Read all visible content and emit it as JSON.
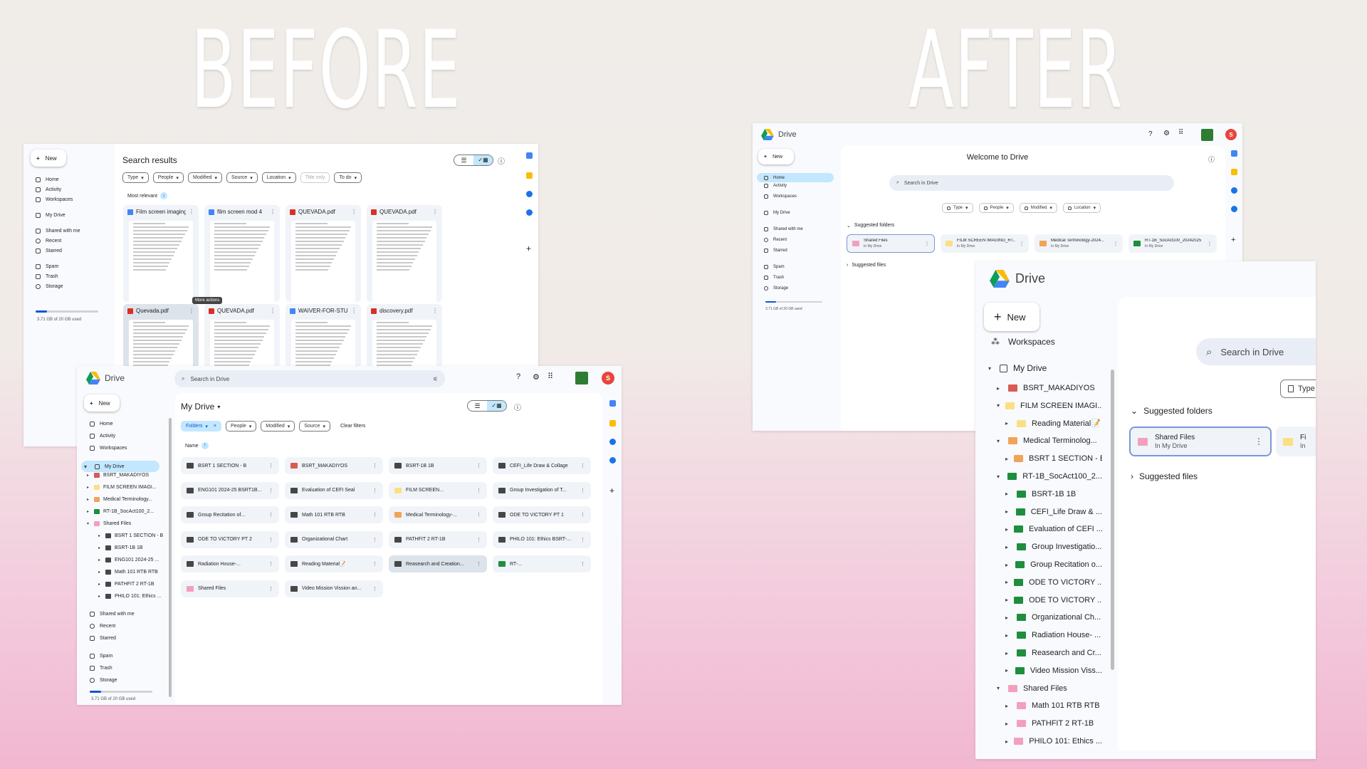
{
  "headings": {
    "before": "BEFORE",
    "after": "AFTER"
  },
  "colors": {
    "accent": "#0b57d0",
    "sidebar_active": "#c2e7ff",
    "avatar": "#e8453c",
    "folder_pink": "#f2a0bd",
    "folder_yellow": "#fbe083",
    "folder_orange": "#f2a35a",
    "folder_green": "#1e8e3e",
    "folder_red": "#d85b55",
    "folder_dark": "#444746"
  },
  "p1": {
    "new": "New",
    "nav": [
      {
        "label": "Home",
        "icon": "home-icon"
      },
      {
        "label": "Activity",
        "icon": "bell-icon"
      },
      {
        "label": "Workspaces",
        "icon": "workspaces-icon"
      },
      {
        "label": "My Drive",
        "icon": "drive-icon"
      },
      {
        "label": "Shared with me",
        "icon": "people-icon"
      },
      {
        "label": "Recent",
        "icon": "clock-icon"
      },
      {
        "label": "Starred",
        "icon": "star-icon"
      },
      {
        "label": "Spam",
        "icon": "spam-icon"
      },
      {
        "label": "Trash",
        "icon": "trash-icon"
      },
      {
        "label": "Storage",
        "icon": "cloud-icon"
      }
    ],
    "storage": "3.71 GB of 20 GB used",
    "storage_fraction": 0.186,
    "title": "Search results",
    "chips": [
      "Type",
      "People",
      "Modified",
      "Source",
      "Location",
      "Title only",
      "To do"
    ],
    "sort": "Most relevant",
    "tooltip": "More actions",
    "files": [
      "Film screen imaging mod...",
      "film screen mod 4",
      "QUEVADA.pdf",
      "QUEVADA.pdf",
      "Quevada.pdf",
      "QUEVADA.pdf",
      "WAIVER-FOR-STUDENT...",
      "discovery.pdf"
    ]
  },
  "p2": {
    "brand": "Drive",
    "search": "Search in Drive",
    "new": "New",
    "avatar": "S",
    "nav_top": [
      {
        "label": "Home",
        "icon": "home-icon"
      },
      {
        "label": "Activity",
        "icon": "bell-icon"
      },
      {
        "label": "Workspaces",
        "icon": "workspaces-icon"
      }
    ],
    "my_drive": "My Drive",
    "tree": [
      {
        "label": "BSRT_MAKADIYOS",
        "color": "#d85b55",
        "indent": 1
      },
      {
        "label": "FILM SCREEN IMAGI...",
        "color": "#fbe083",
        "indent": 1
      },
      {
        "label": "Medical Terminology...",
        "color": "#f2a35a",
        "indent": 1
      },
      {
        "label": "RT-1B_SocAct100_2...",
        "color": "#1e8e3e",
        "indent": 1
      },
      {
        "label": "Shared Files",
        "color": "#f2a0bd",
        "indent": 1
      },
      {
        "label": "BSRT 1 SECTION - B",
        "color": "#444746",
        "indent": 2
      },
      {
        "label": "BSRT-1B 1B",
        "color": "#444746",
        "indent": 2
      },
      {
        "label": "ENG101 2024-25 ...",
        "color": "#444746",
        "indent": 2
      },
      {
        "label": "Math 101 RTB RTB",
        "color": "#444746",
        "indent": 2
      },
      {
        "label": "PATHFIT 2 RT-1B",
        "color": "#444746",
        "indent": 2
      },
      {
        "label": "PHILO 101: Ethics ...",
        "color": "#444746",
        "indent": 2
      }
    ],
    "nav_bottom": [
      {
        "label": "Shared with me",
        "icon": "people-icon"
      },
      {
        "label": "Recent",
        "icon": "clock-icon"
      },
      {
        "label": "Starred",
        "icon": "star-icon"
      },
      {
        "label": "Spam",
        "icon": "spam-icon"
      },
      {
        "label": "Trash",
        "icon": "trash-icon"
      },
      {
        "label": "Storage",
        "icon": "cloud-icon"
      }
    ],
    "storage": "3.71 GB of 20 GB used",
    "storage_fraction": 0.186,
    "title": "My Drive",
    "chips": [
      "Folders",
      "People",
      "Modified",
      "Source"
    ],
    "clear": "Clear filters",
    "col": "Name",
    "folders": [
      {
        "label": "BSRT 1 SECTION - B",
        "color": "#444746"
      },
      {
        "label": "BSRT_MAKADIYOS",
        "color": "#d85b55"
      },
      {
        "label": "BSRT-1B 1B",
        "color": "#444746"
      },
      {
        "label": "CEFI_Life Draw & Collage",
        "color": "#444746"
      },
      {
        "label": "ENG101 2024-25 BSRT1B...",
        "color": "#444746"
      },
      {
        "label": "Evaluation of CEFI Seal",
        "color": "#444746"
      },
      {
        "label": "FILM SCREEN...",
        "color": "#fbe083"
      },
      {
        "label": "Group Investigation of T...",
        "color": "#444746"
      },
      {
        "label": "Group Recitation of...",
        "color": "#444746"
      },
      {
        "label": "Math 101 RTB RTB",
        "color": "#444746"
      },
      {
        "label": "Medical Terminology-...",
        "color": "#f2a35a"
      },
      {
        "label": "ODE TO VICTORY PT 1",
        "color": "#444746"
      },
      {
        "label": "ODE TO VICTORY PT 2",
        "color": "#444746"
      },
      {
        "label": "Organizational Chart",
        "color": "#444746"
      },
      {
        "label": "PATHFIT 2 RT-1B",
        "color": "#444746"
      },
      {
        "label": "PHILO 101: Ethics BSRT-...",
        "color": "#444746"
      },
      {
        "label": "Radiation House-...",
        "color": "#444746"
      },
      {
        "label": "Reading Material📝",
        "color": "#444746"
      },
      {
        "label": "Reasearch and Creation...",
        "color": "#444746"
      },
      {
        "label": "RT-...",
        "color": "#1e8e3e"
      },
      {
        "label": "Shared Files",
        "color": "#f2a0bd"
      },
      {
        "label": "Video Mission Vission an...",
        "color": "#444746"
      }
    ]
  },
  "p3": {
    "brand": "Drive",
    "new": "New",
    "avatar": "S",
    "welcome": "Welcome to Drive",
    "search": "Search in Drive",
    "nav": [
      {
        "label": "Home",
        "icon": "home-icon"
      },
      {
        "label": "Activity",
        "icon": "bell-icon"
      },
      {
        "label": "Workspaces",
        "icon": "workspaces-icon"
      },
      {
        "label": "My Drive",
        "icon": "drive-icon"
      },
      {
        "label": "Shared with me",
        "icon": "people-icon"
      },
      {
        "label": "Recent",
        "icon": "clock-icon"
      },
      {
        "label": "Starred",
        "icon": "star-icon"
      },
      {
        "label": "Spam",
        "icon": "spam-icon"
      },
      {
        "label": "Trash",
        "icon": "trash-icon"
      },
      {
        "label": "Storage",
        "icon": "cloud-icon"
      }
    ],
    "storage": "3.71 GB of 20 GB used",
    "storage_fraction": 0.186,
    "chips": [
      "Type",
      "People",
      "Modified",
      "Location"
    ],
    "suggested_folders": "Suggested folders",
    "suggested_files": "Suggested files",
    "sugg": [
      {
        "name": "Shared Files",
        "sub": "In My Drive",
        "color": "#f2a0bd"
      },
      {
        "name": "FILM SCREEN IMAGING_RT...",
        "sub": "In My Drive",
        "color": "#fbe083"
      },
      {
        "name": "Medical Terminology-2024...",
        "sub": "In My Drive",
        "color": "#f2a35a"
      },
      {
        "name": "RT-1B_SocAct100_20242025",
        "sub": "In My Drive",
        "color": "#1e8e3e"
      }
    ]
  },
  "p4": {
    "brand": "Drive",
    "new": "New",
    "workspaces": "Workspaces",
    "my_drive": "My Drive",
    "search": "Search in Drive",
    "type_chip": "Type",
    "suggested_folders": "Suggested folders",
    "suggested_files": "Suggested files",
    "card": {
      "name": "Shared Files",
      "sub": "In My Drive"
    },
    "card2": {
      "name": "Fi",
      "sub": "In"
    },
    "tree": [
      {
        "label": "BSRT_MAKADIYOS",
        "color": "#d85b55",
        "indent": 1,
        "open": false
      },
      {
        "label": "FILM SCREEN IMAGI...",
        "color": "#fbe083",
        "indent": 1,
        "open": true
      },
      {
        "label": "Reading Material📝",
        "color": "#fbe083",
        "indent": 2,
        "open": false
      },
      {
        "label": "Medical Terminolog...",
        "color": "#f2a35a",
        "indent": 1,
        "open": true
      },
      {
        "label": "BSRT 1 SECTION - B",
        "color": "#f2a35a",
        "indent": 2,
        "open": false
      },
      {
        "label": "RT-1B_SocAct100_2...",
        "color": "#1e8e3e",
        "indent": 1,
        "open": true
      },
      {
        "label": "BSRT-1B 1B",
        "color": "#1e8e3e",
        "indent": 2,
        "open": false
      },
      {
        "label": "CEFI_Life Draw & ...",
        "color": "#1e8e3e",
        "indent": 2,
        "open": false
      },
      {
        "label": "Evaluation of CEFI ...",
        "color": "#1e8e3e",
        "indent": 2,
        "open": false
      },
      {
        "label": "Group Investigatio...",
        "color": "#1e8e3e",
        "indent": 2,
        "open": false
      },
      {
        "label": "Group Recitation o...",
        "color": "#1e8e3e",
        "indent": 2,
        "open": false
      },
      {
        "label": "ODE TO VICTORY ...",
        "color": "#1e8e3e",
        "indent": 2,
        "open": false
      },
      {
        "label": "ODE TO VICTORY ...",
        "color": "#1e8e3e",
        "indent": 2,
        "open": false
      },
      {
        "label": "Organizational Ch...",
        "color": "#1e8e3e",
        "indent": 2,
        "open": false
      },
      {
        "label": "Radiation House- ...",
        "color": "#1e8e3e",
        "indent": 2,
        "open": false
      },
      {
        "label": "Reasearch and Cr...",
        "color": "#1e8e3e",
        "indent": 2,
        "open": false
      },
      {
        "label": "Video Mission Viss...",
        "color": "#1e8e3e",
        "indent": 2,
        "open": false
      },
      {
        "label": "Shared Files",
        "color": "#f2a0bd",
        "indent": 1,
        "open": true
      },
      {
        "label": "Math 101 RTB RTB",
        "color": "#f2a0bd",
        "indent": 2,
        "open": false
      },
      {
        "label": "PATHFIT 2 RT-1B",
        "color": "#f2a0bd",
        "indent": 2,
        "open": false
      },
      {
        "label": "PHILO 101: Ethics ...",
        "color": "#f2a0bd",
        "indent": 2,
        "open": false
      }
    ]
  }
}
